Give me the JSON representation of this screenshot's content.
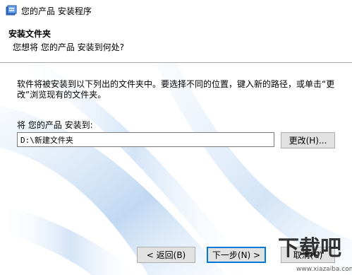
{
  "window": {
    "title": "您的产品 安装程序"
  },
  "header": {
    "title": "安装文件夹",
    "subtitle": "您想将 您的产品 安装到何处?"
  },
  "main": {
    "description": "软件将被安装到以下列出的文件夹中。要选择不同的位置，键入新的路径，或单击“更改”浏览现有的文件夹。",
    "install_label": "将 您的产品 安装到:",
    "path_value": "D:\\新建文件夹",
    "change_button": "更改(H)..."
  },
  "footer": {
    "back_button": "< 返回(B)",
    "next_button": "下一步(N) >",
    "cancel_button": "取消(C)"
  },
  "watermark": {
    "text": "下载吧",
    "url": "www.xiazaiba.com"
  }
}
